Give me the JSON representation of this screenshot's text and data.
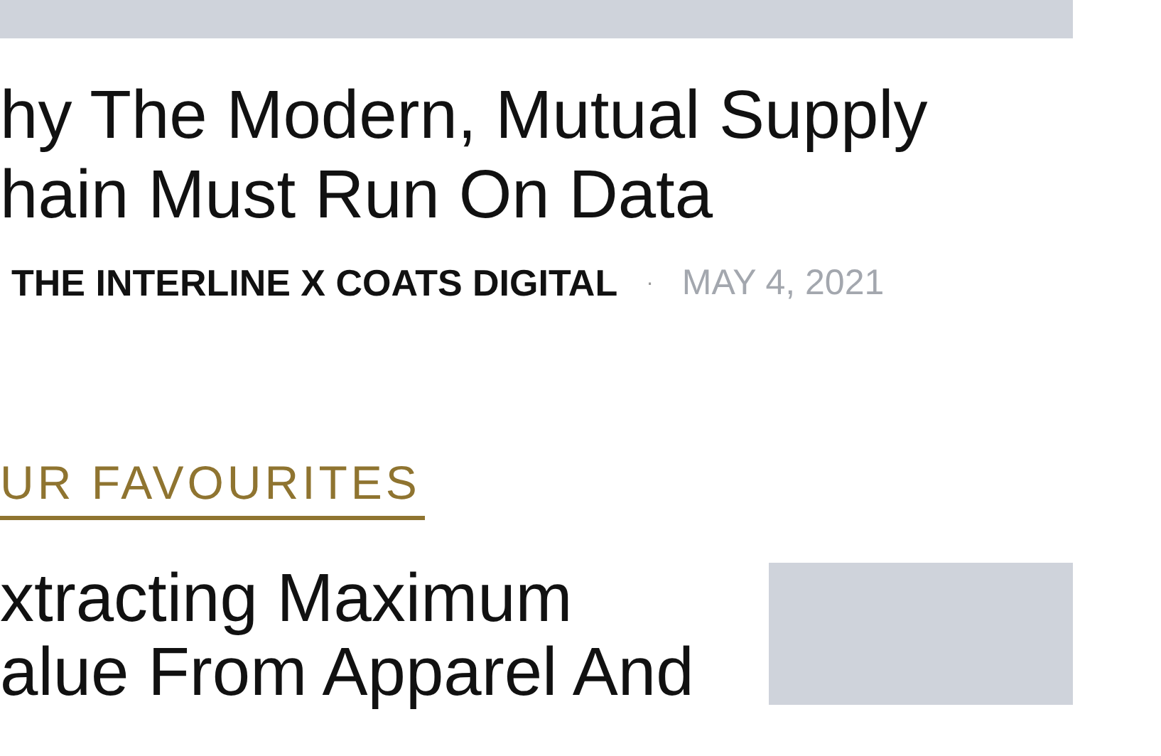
{
  "featured_post": {
    "title_lines": [
      "hy The Modern, Mutual Supply",
      "hain Must Run On Data"
    ],
    "author": "THE INTERLINE X COATS DIGITAL",
    "separator": "·",
    "date": "MAY 4, 2021"
  },
  "section": {
    "heading": "UR FAVOURITES"
  },
  "posts": [
    {
      "title_lines": [
        "xtracting Maximum",
        "alue From Apparel And"
      ]
    }
  ]
}
